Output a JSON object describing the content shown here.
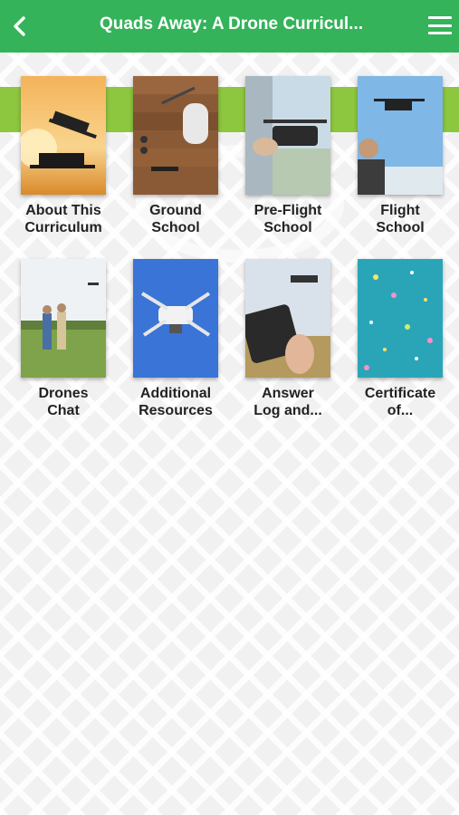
{
  "header": {
    "title": "Quads Away: A Drone Curricul...",
    "back_icon": "chevron-left-icon",
    "menu_icon": "hamburger-menu-icon"
  },
  "colors": {
    "header_green": "#34b35a",
    "band_green": "#8dc63f"
  },
  "tiles": [
    {
      "line1": "About This",
      "line2": "Curriculum"
    },
    {
      "line1": "Ground",
      "line2": "School"
    },
    {
      "line1": "Pre-Flight",
      "line2": "School"
    },
    {
      "line1": "Flight",
      "line2": "School"
    },
    {
      "line1": "Drones",
      "line2": "Chat"
    },
    {
      "line1": "Additional",
      "line2": "Resources"
    },
    {
      "line1": "Answer",
      "line2": "Log and..."
    },
    {
      "line1": "Certificate",
      "line2": "of..."
    }
  ]
}
